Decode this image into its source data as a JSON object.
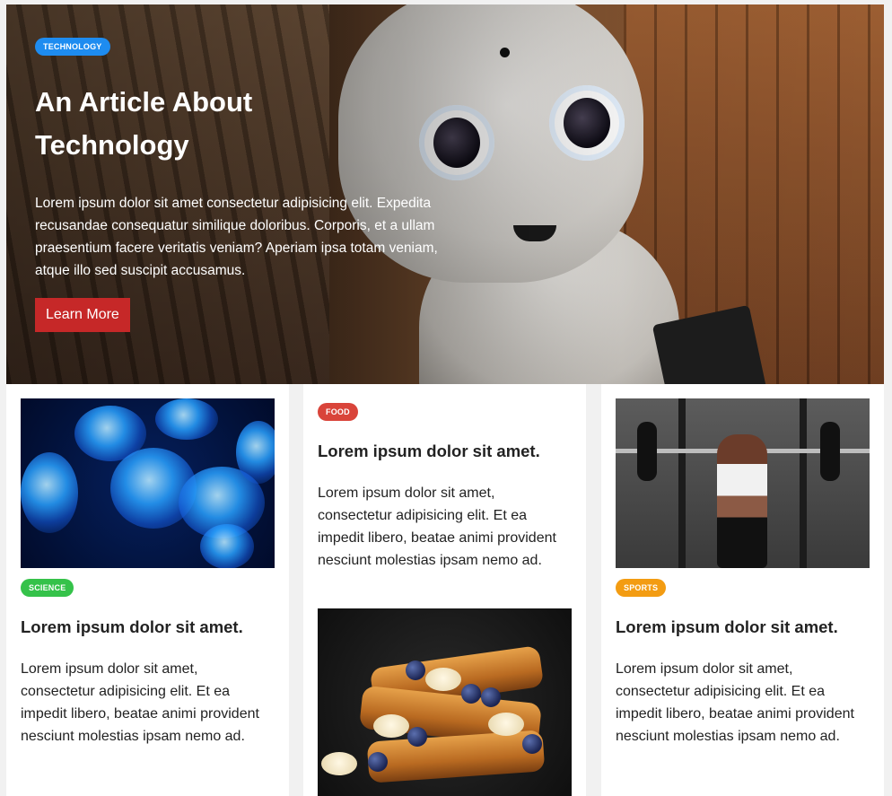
{
  "hero": {
    "badge": "TECHNOLOGY",
    "badge_color": "#1e8cf0",
    "title_line1": "An Article About",
    "title_line2": "Technology",
    "text": "Lorem ipsum dolor sit amet consectetur adipisicing elit. Expedita recusandae consequatur similique doloribus. Corporis, et a ullam praesentium facere veritatis veniam? Aperiam ipsa totam veniam, atque illo sed suscipit accusamus.",
    "button_label": "Learn More",
    "button_color": "#c62828",
    "image_subject": "robot"
  },
  "cards": [
    {
      "badge": "SCIENCE",
      "badge_color": "#35c24a",
      "title": "Lorem ipsum dolor sit amet.",
      "text": "Lorem ipsum dolor sit amet, consectetur adipisicing elit. Et ea impedit libero, beatae animi provident nesciunt molestias ipsam nemo ad.",
      "image_subject": "jellyfish"
    },
    {
      "badge": "FOOD",
      "badge_color": "#d9443a",
      "title": "Lorem ipsum dolor sit amet.",
      "text": "Lorem ipsum dolor sit amet, consectetur adipisicing elit. Et ea impedit libero, beatae animi provident nesciunt molestias ipsam nemo ad.",
      "image_subject": "french-toast"
    },
    {
      "badge": "SPORTS",
      "badge_color": "#f39c12",
      "title": "Lorem ipsum dolor sit amet.",
      "text": "Lorem ipsum dolor sit amet, consectetur adipisicing elit. Et ea impedit libero, beatae animi provident nesciunt molestias ipsam nemo ad.",
      "image_subject": "weightlifting"
    }
  ]
}
